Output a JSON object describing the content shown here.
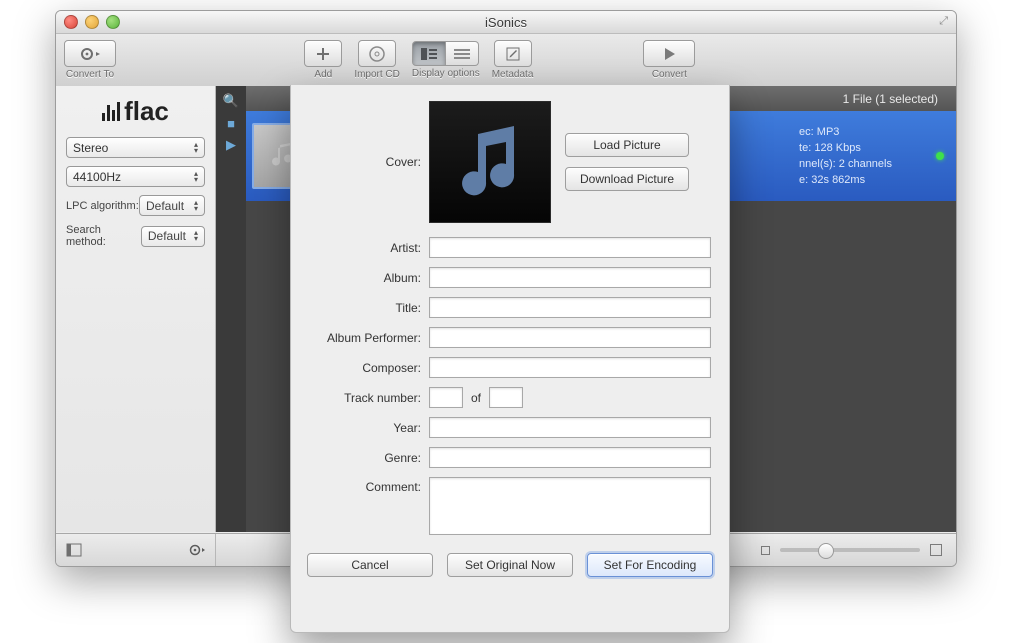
{
  "window": {
    "title": "iSonics"
  },
  "toolbar": {
    "convert_to_label": "Convert To",
    "add_label": "Add",
    "import_cd_label": "Import CD",
    "display_options_label": "Display options",
    "metadata_label": "Metadata",
    "convert_label": "Convert"
  },
  "sidebar": {
    "logo_text": "flac",
    "channels_value": "Stereo",
    "samplerate_value": "44100Hz",
    "lpc_label": "LPC algorithm:",
    "lpc_value": "Default",
    "search_label": "Search method:",
    "search_value": "Default"
  },
  "main": {
    "count_text": "1 File (1 selected)",
    "info_codec": "ec: MP3",
    "info_bitrate": "te: 128 Kbps",
    "info_channels": "nnel(s): 2 channels",
    "info_duration": "e: 32s 862ms"
  },
  "sheet": {
    "cover_label": "Cover:",
    "load_picture": "Load Picture",
    "download_picture": "Download Picture",
    "artist_label": "Artist:",
    "album_label": "Album:",
    "title_label": "Title:",
    "album_performer_label": "Album Performer:",
    "composer_label": "Composer:",
    "track_label": "Track number:",
    "of_label": "of",
    "year_label": "Year:",
    "genre_label": "Genre:",
    "comment_label": "Comment:",
    "cancel": "Cancel",
    "set_original": "Set Original Now",
    "set_encoding": "Set For Encoding",
    "values": {
      "artist": "",
      "album": "",
      "title": "",
      "album_performer": "",
      "composer": "",
      "track_n": "",
      "track_total": "",
      "year": "",
      "genre": "",
      "comment": ""
    }
  }
}
